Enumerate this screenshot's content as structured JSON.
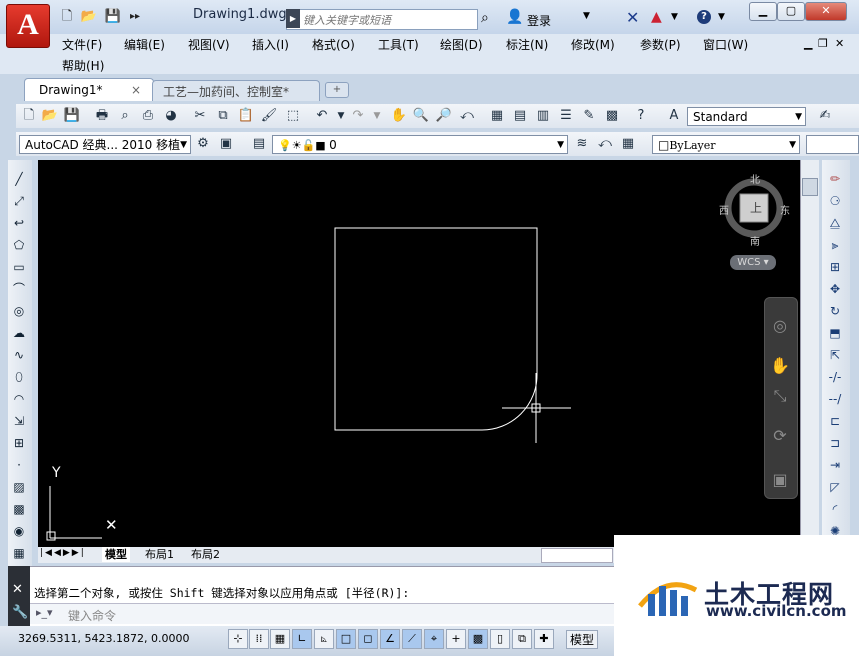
{
  "app": {
    "logo": "A",
    "document_title": "Drawing1.dwg"
  },
  "search": {
    "placeholder": "键入关键字或短语"
  },
  "login": {
    "label": "登录"
  },
  "menu": {
    "items": [
      "文件(F)",
      "编辑(E)",
      "视图(V)",
      "插入(I)",
      "格式(O)",
      "工具(T)",
      "绘图(D)",
      "标注(N)",
      "修改(M)",
      "参数(P)",
      "窗口(W)"
    ],
    "help": "帮助(H)"
  },
  "tabs": [
    {
      "label": "Drawing1*",
      "close": "×"
    },
    {
      "label": "工艺—加药间、控制室*"
    }
  ],
  "toolbar": {
    "text_style": "Standard",
    "workspace": "AutoCAD 经典... 2010 移植",
    "layer": "0",
    "linetype": "ByLayer"
  },
  "viewcube": {
    "north": "北",
    "south": "南",
    "east": "东",
    "west": "西",
    "top_face": "上",
    "wcs": "WCS"
  },
  "ucs": {
    "y": "Y",
    "x": "X"
  },
  "layout_tabs": [
    "模型",
    "布局1",
    "布局2"
  ],
  "command": {
    "prompt": "选择第二个对象, 或按住 Shift 键选择对象以应用角点或 [半径(R)]:",
    "input_placeholder": "键入命令"
  },
  "status": {
    "coordinates": "3269.5311, 5423.1872, 0.0000",
    "model": "模型"
  },
  "watermark": {
    "name": "土木工程网",
    "url": "www.civilcn.com"
  }
}
